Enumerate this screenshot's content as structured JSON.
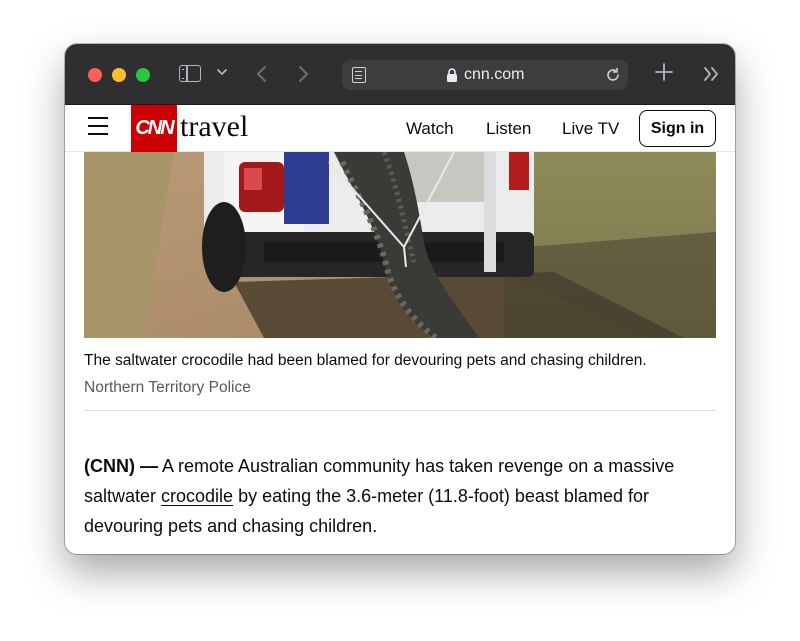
{
  "browser": {
    "url": "cnn.com"
  },
  "site": {
    "logo_text": "CNN",
    "section": "travel",
    "nav": [
      {
        "label": "Watch"
      },
      {
        "label": "Listen"
      },
      {
        "label": "Live TV"
      }
    ],
    "sign_in_label": "Sign in",
    "brand_color": "#cc0000"
  },
  "article": {
    "image_caption": "The saltwater crocodile had been blamed for devouring pets and chasing children.",
    "image_credit": "Northern Territory Police",
    "dateline": "(CNN) —",
    "body_before_link": " A remote Australian community has taken revenge on a massive saltwater ",
    "body_link": "crocodile",
    "body_after_link": " by eating the 3.6-meter (11.8-foot) beast blamed for devouring pets and chasing children."
  },
  "icons": {
    "sidebar": "sidebar-icon",
    "tab_overview": "chevron-down-icon",
    "back": "chevron-left-icon",
    "forward": "chevron-right-icon",
    "reader": "reader-icon",
    "lock": "lock-icon",
    "reload": "reload-icon",
    "new_tab": "plus-icon",
    "more": "double-chevron-icon",
    "menu": "hamburger-icon"
  }
}
